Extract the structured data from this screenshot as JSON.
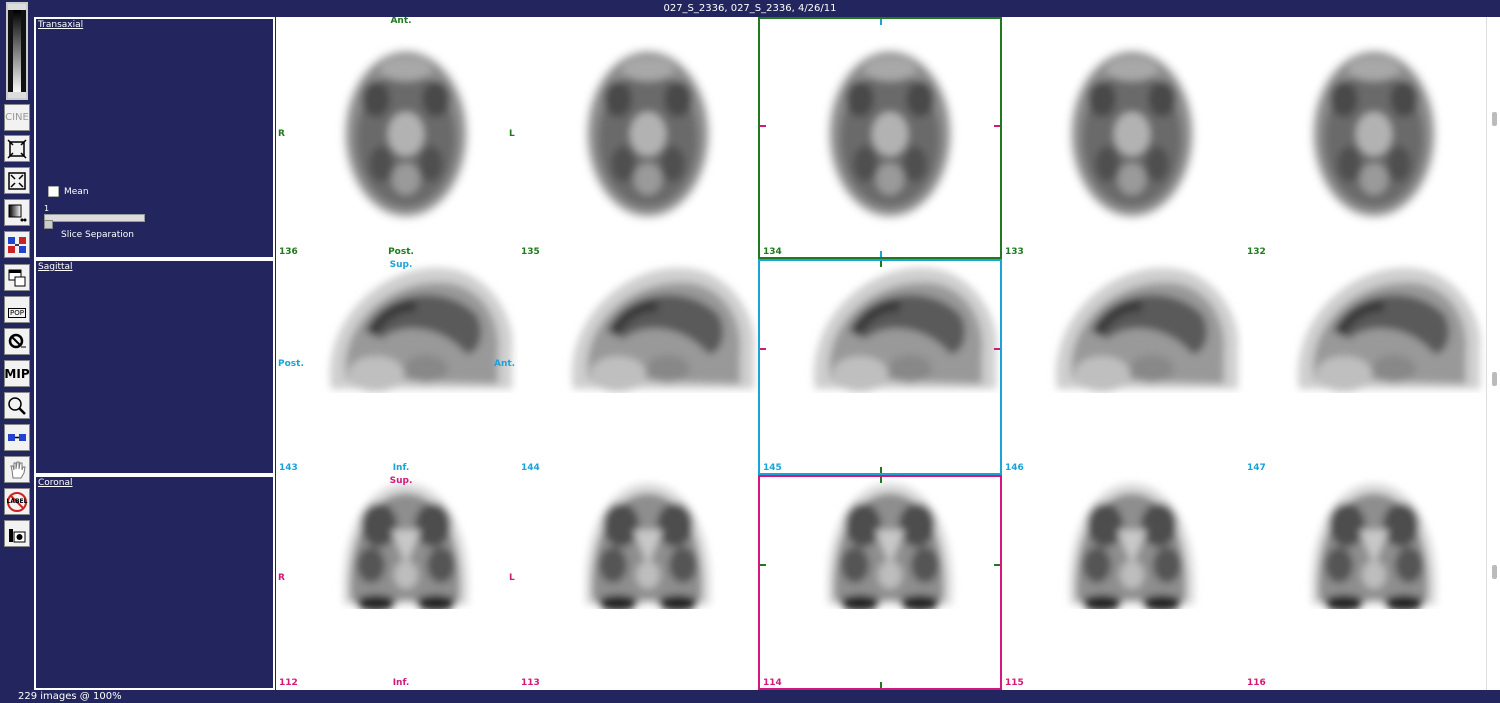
{
  "window": {
    "title": "027_S_2336, 027_S_2336, 4/26/11",
    "status": "229 images @ 100%"
  },
  "toolbar": {
    "cine_label": "CINE",
    "pop_label": "POP",
    "mip_label": "MIP",
    "label_tool": "LABEL"
  },
  "panels": {
    "transaxial": {
      "title": "Transaxial",
      "mean_label": "Mean",
      "slider_value": "1",
      "slider_label": "Slice Separation"
    },
    "sagittal": {
      "title": "Sagittal"
    },
    "coronal": {
      "title": "Coronal"
    }
  },
  "viewer": {
    "transaxial": {
      "top": "Ant.",
      "bottom": "Post.",
      "left": "R",
      "right": "L",
      "slices": [
        "136",
        "135",
        "134",
        "133",
        "132"
      ]
    },
    "sagittal": {
      "top": "Sup.",
      "bottom": "Inf.",
      "left": "Post.",
      "right": "Ant.",
      "slices": [
        "143",
        "144",
        "145",
        "146",
        "147"
      ]
    },
    "coronal": {
      "top": "Sup.",
      "bottom": "Inf.",
      "left": "R",
      "right": "L",
      "slices": [
        "112",
        "113",
        "114",
        "115",
        "116"
      ]
    }
  },
  "colors": {
    "background": "#23265e",
    "transaxial": "#1f7a1f",
    "sagittal": "#1aa3d9",
    "coronal": "#d6177a"
  }
}
